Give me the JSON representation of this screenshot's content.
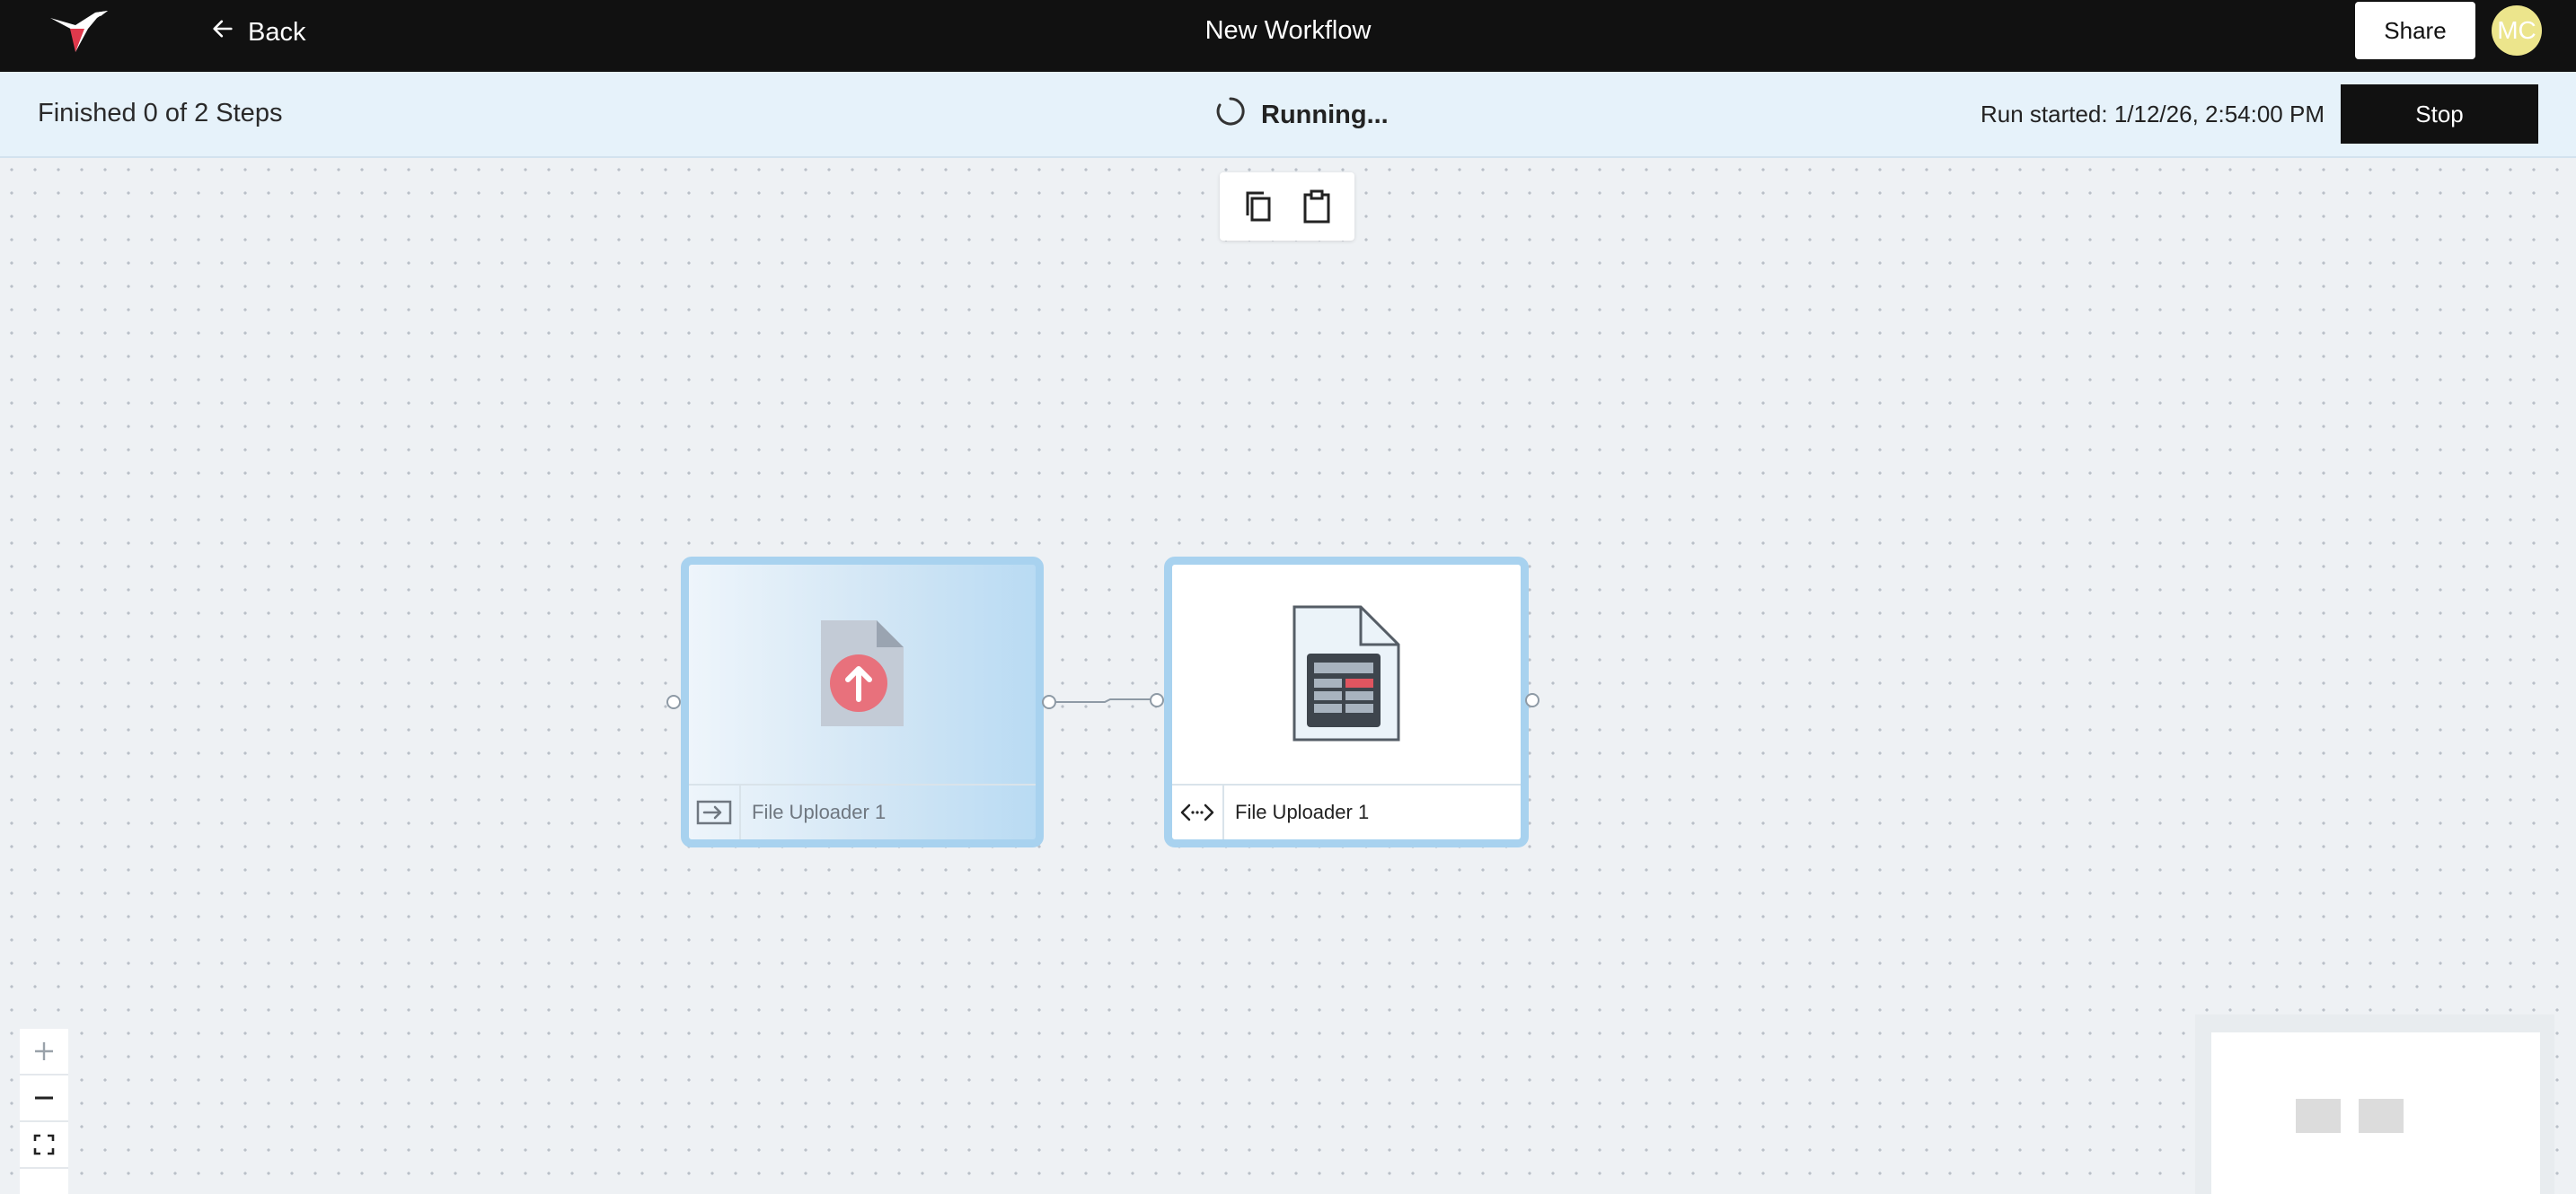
{
  "header": {
    "back_label": "Back",
    "title": "New Workflow",
    "share_label": "Share",
    "avatar_initials": "MC"
  },
  "status": {
    "steps_text": "Finished 0 of 2 Steps",
    "running_text": "Running...",
    "run_started_text": "Run started: 1/12/26, 2:54:00 PM",
    "stop_label": "Stop"
  },
  "toolbar": {
    "icons": [
      "copy-icon",
      "paste-icon"
    ]
  },
  "nodes": [
    {
      "label": "File Uploader 1",
      "icon": "file-upload-icon",
      "footer_icon": "input-icon",
      "state": "running"
    },
    {
      "label": "File Uploader 1",
      "icon": "spreadsheet-file-icon",
      "footer_icon": "code-icon",
      "state": "idle"
    }
  ],
  "zoom": {
    "icons": [
      "zoom-in-icon",
      "zoom-out-icon",
      "fit-view-icon"
    ]
  },
  "colors": {
    "header_bg": "#111111",
    "status_bg": "#e6f2fa",
    "node_border": "#a8d2ef",
    "upload_accent": "#e8717c",
    "avatar_bg": "#ece58c"
  }
}
